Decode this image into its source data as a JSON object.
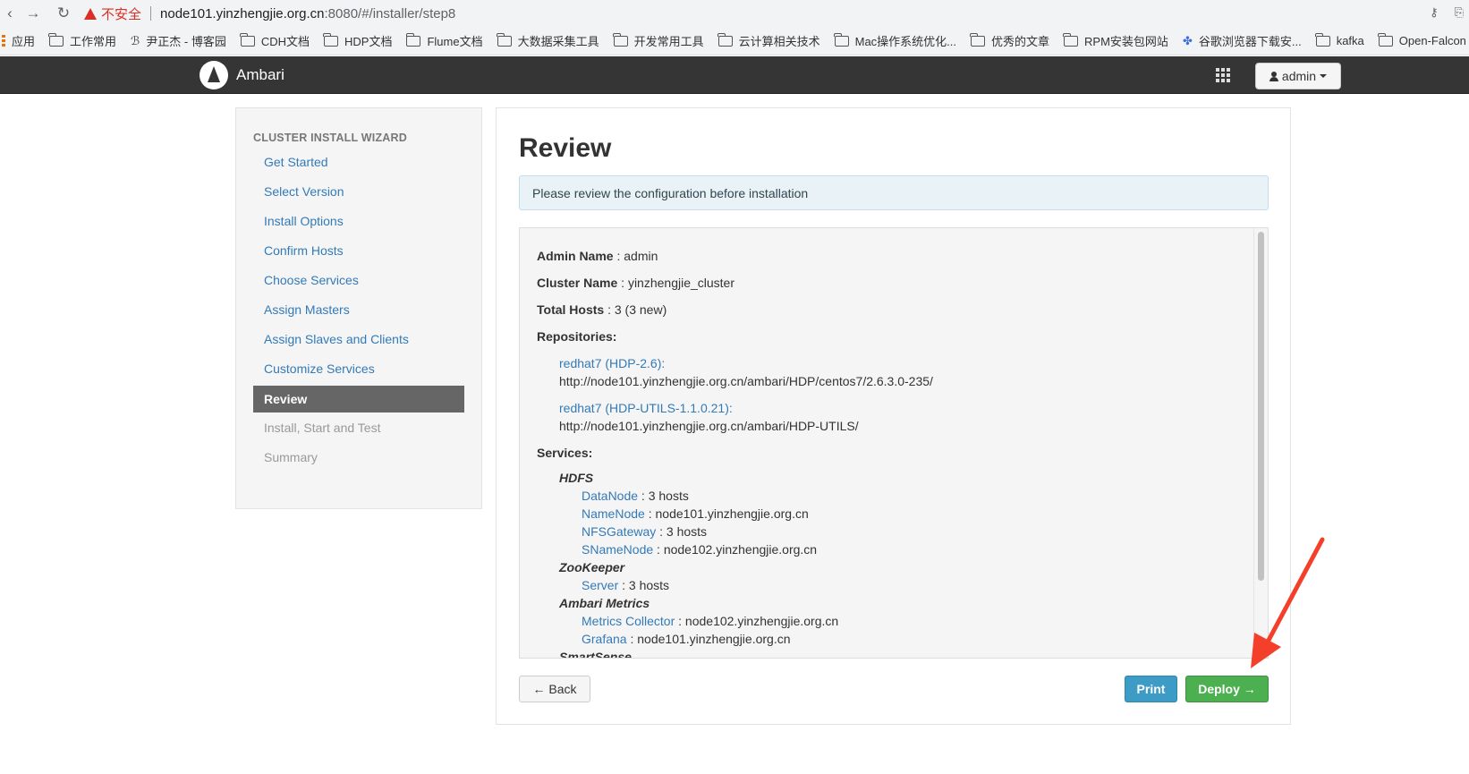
{
  "browser": {
    "security_label": "不安全",
    "url_host": "node101.yinzhengjie.org.cn",
    "url_rest": ":8080/#/installer/step8",
    "bookmarks": [
      {
        "label": "应用",
        "icon": "apps-icon"
      },
      {
        "label": "工作常用",
        "icon": "folder-icon"
      },
      {
        "label": "尹正杰 - 博客园",
        "icon": "blog-icon"
      },
      {
        "label": "CDH文档",
        "icon": "folder-icon"
      },
      {
        "label": "HDP文档",
        "icon": "folder-icon"
      },
      {
        "label": "Flume文档",
        "icon": "folder-icon"
      },
      {
        "label": "大数据采集工具",
        "icon": "folder-icon"
      },
      {
        "label": "开发常用工具",
        "icon": "folder-icon"
      },
      {
        "label": "云计算相关技术",
        "icon": "folder-icon"
      },
      {
        "label": "Mac操作系统优化...",
        "icon": "folder-icon"
      },
      {
        "label": "优秀的文章",
        "icon": "folder-icon"
      },
      {
        "label": "RPM安装包网站",
        "icon": "folder-icon"
      },
      {
        "label": "谷歌浏览器下载安...",
        "icon": "paw-icon"
      },
      {
        "label": "kafka",
        "icon": "folder-icon"
      },
      {
        "label": "Open-Falcon",
        "icon": "folder-icon"
      }
    ]
  },
  "header": {
    "brand": "Ambari",
    "user_label": "admin"
  },
  "wizard": {
    "title": "CLUSTER INSTALL WIZARD",
    "steps": [
      {
        "label": "Get Started",
        "state": "link"
      },
      {
        "label": "Select Version",
        "state": "link"
      },
      {
        "label": "Install Options",
        "state": "link"
      },
      {
        "label": "Confirm Hosts",
        "state": "link"
      },
      {
        "label": "Choose Services",
        "state": "link"
      },
      {
        "label": "Assign Masters",
        "state": "link"
      },
      {
        "label": "Assign Slaves and Clients",
        "state": "link"
      },
      {
        "label": "Customize Services",
        "state": "link"
      },
      {
        "label": "Review",
        "state": "active"
      },
      {
        "label": "Install, Start and Test",
        "state": "disabled"
      },
      {
        "label": "Summary",
        "state": "disabled"
      }
    ]
  },
  "main": {
    "title": "Review",
    "alert": "Please review the configuration before installation",
    "admin_name_label": "Admin Name",
    "admin_name_value": "admin",
    "cluster_name_label": "Cluster Name",
    "cluster_name_value": "yinzhengjie_cluster",
    "total_hosts_label": "Total Hosts",
    "total_hosts_value": "3 (3 new)",
    "repositories_label": "Repositories:",
    "repos": [
      {
        "name": "redhat7 (HDP-2.6):",
        "url": "http://node101.yinzhengjie.org.cn/ambari/HDP/centos7/2.6.3.0-235/"
      },
      {
        "name": "redhat7 (HDP-UTILS-1.1.0.21):",
        "url": "http://node101.yinzhengjie.org.cn/ambari/HDP-UTILS/"
      }
    ],
    "services_label": "Services:",
    "services": [
      {
        "name": "HDFS",
        "components": [
          {
            "name": "DataNode",
            "value": "3 hosts"
          },
          {
            "name": "NameNode",
            "value": "node101.yinzhengjie.org.cn"
          },
          {
            "name": "NFSGateway",
            "value": "3 hosts"
          },
          {
            "name": "SNameNode",
            "value": "node102.yinzhengjie.org.cn"
          }
        ]
      },
      {
        "name": "ZooKeeper",
        "components": [
          {
            "name": "Server",
            "value": "3 hosts"
          }
        ]
      },
      {
        "name": "Ambari Metrics",
        "components": [
          {
            "name": "Metrics Collector",
            "value": "node102.yinzhengjie.org.cn"
          },
          {
            "name": "Grafana",
            "value": "node101.yinzhengjie.org.cn"
          }
        ]
      },
      {
        "name": "SmartSense",
        "components": []
      }
    ],
    "back_label": "← Back",
    "print_label": "Print",
    "deploy_label": "Deploy →"
  },
  "colors": {
    "link": "#337ab7",
    "active_step": "#666666",
    "deploy": "#4caf50",
    "print": "#3c9cc6",
    "annotation_arrow": "#f4402a"
  }
}
